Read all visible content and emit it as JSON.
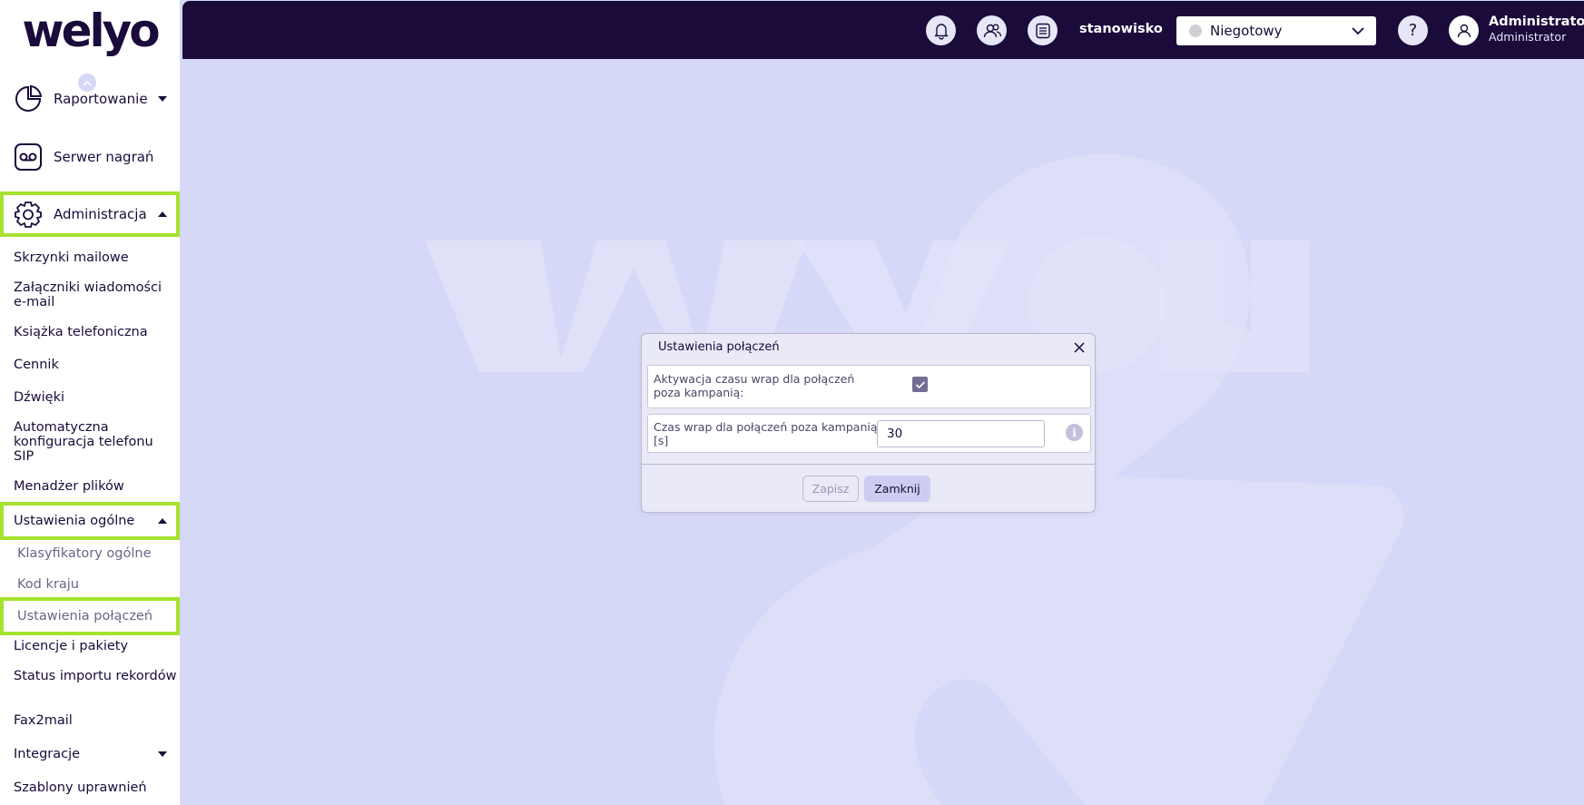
{
  "app": {
    "logo": "welyo",
    "watermark": "we you"
  },
  "sidebar": {
    "main_items": [
      {
        "label": "Raportowanie",
        "icon": "pie-chart-icon"
      },
      {
        "label": "Serwer nagrań",
        "icon": "voicemail-icon"
      },
      {
        "label": "Administracja",
        "icon": "gear-icon"
      }
    ],
    "admin_items": [
      "Skrzynki mailowe",
      "Załączniki wiadomości e-mail",
      "Książka telefoniczna",
      "Cennik",
      "Dźwięki",
      "Automatyczna konfiguracja telefonu SIP",
      "Menadżer plików",
      "Ustawienia ogólne",
      "Licencje i pakiety",
      "Status importu rekordów",
      "Fax2mail",
      "Integracje",
      "Szablony uprawnień"
    ],
    "general_subitems": [
      "Klasyfikatory ogólne",
      "Kod kraju",
      "Ustawienia połączeń"
    ]
  },
  "topbar": {
    "icons": [
      "bell-icon",
      "users-icon",
      "list-icon",
      "help-icon",
      "user-icon"
    ],
    "workstation": "stanowisko",
    "status": {
      "value": "Niegotowy",
      "dot_color": "#cfcfd6"
    },
    "help": "?",
    "user": {
      "name": "Administrator",
      "role": "Administrator"
    }
  },
  "dialog": {
    "title": "Ustawienia połączeń",
    "field_wrap_activation": {
      "label": "Aktywacja czasu wrap dla połączeń poza kampanią:",
      "checked": true
    },
    "field_wrap_time": {
      "label": "Czas wrap dla połączeń poza kampanią [s]",
      "value": "30"
    },
    "save_label": "Zapisz",
    "close_label": "Zamknij"
  },
  "colors": {
    "accent": "#1a0b3b",
    "highlight": "#a6e22e",
    "background": "#d6d8f7"
  }
}
